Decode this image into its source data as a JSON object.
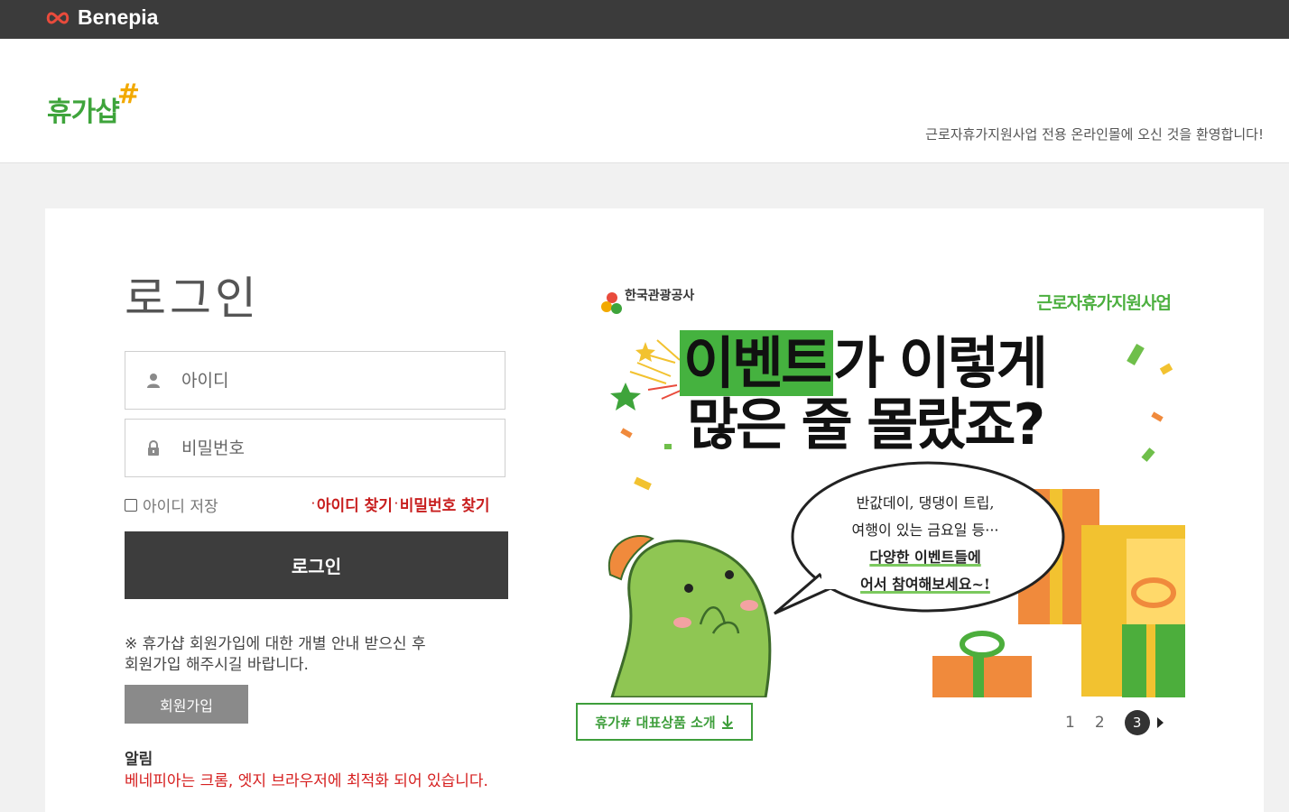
{
  "topbar": {
    "brand": "Benepia",
    "brand_color": "#e94b3c"
  },
  "header": {
    "logo": "휴가샵",
    "logo_hash": "#",
    "welcome": "근로자휴가지원사업 전용 온라인몰에 오신 것을 환영합니다!"
  },
  "login": {
    "title": "로그인",
    "id_placeholder": "아이디",
    "pw_placeholder": "비밀번호",
    "remember_label": "아이디 저장",
    "find_id": "아이디 찾기",
    "find_pw": "비밀번호 찾기",
    "button": "로그인",
    "notice_line1": "※ 휴가샵 회원가입에 대한 개별 안내 받으신 후",
    "notice_line2": "회원가입 해주시길 바랍니다.",
    "join_button": "회원가입",
    "alert_title": "알림",
    "alert_text": "베네피아는 크롬, 엣지 브라우저에 최적화 되어 있습니다."
  },
  "banner": {
    "org": "한국관광공사",
    "program": "근로자휴가지원사업",
    "headline_highlight": "이벤트",
    "headline_rest": "가 이렇게",
    "headline_line2": "많은 줄 몰랐죠?",
    "bubble_line1": "반값데이, 댕댕이 트립,",
    "bubble_line2": "여행이 있는 금요일 등···",
    "bubble_line3": "다양한 이벤트들에",
    "bubble_line4": "어서 참여해보세요~!",
    "product_button": "휴가# 대표상품 소개",
    "pager": [
      "1",
      "2",
      "3"
    ],
    "current_page": "3"
  },
  "colors": {
    "accent_green": "#3ea43b",
    "alert_red": "#d62020",
    "dark": "#3d3d3d"
  }
}
